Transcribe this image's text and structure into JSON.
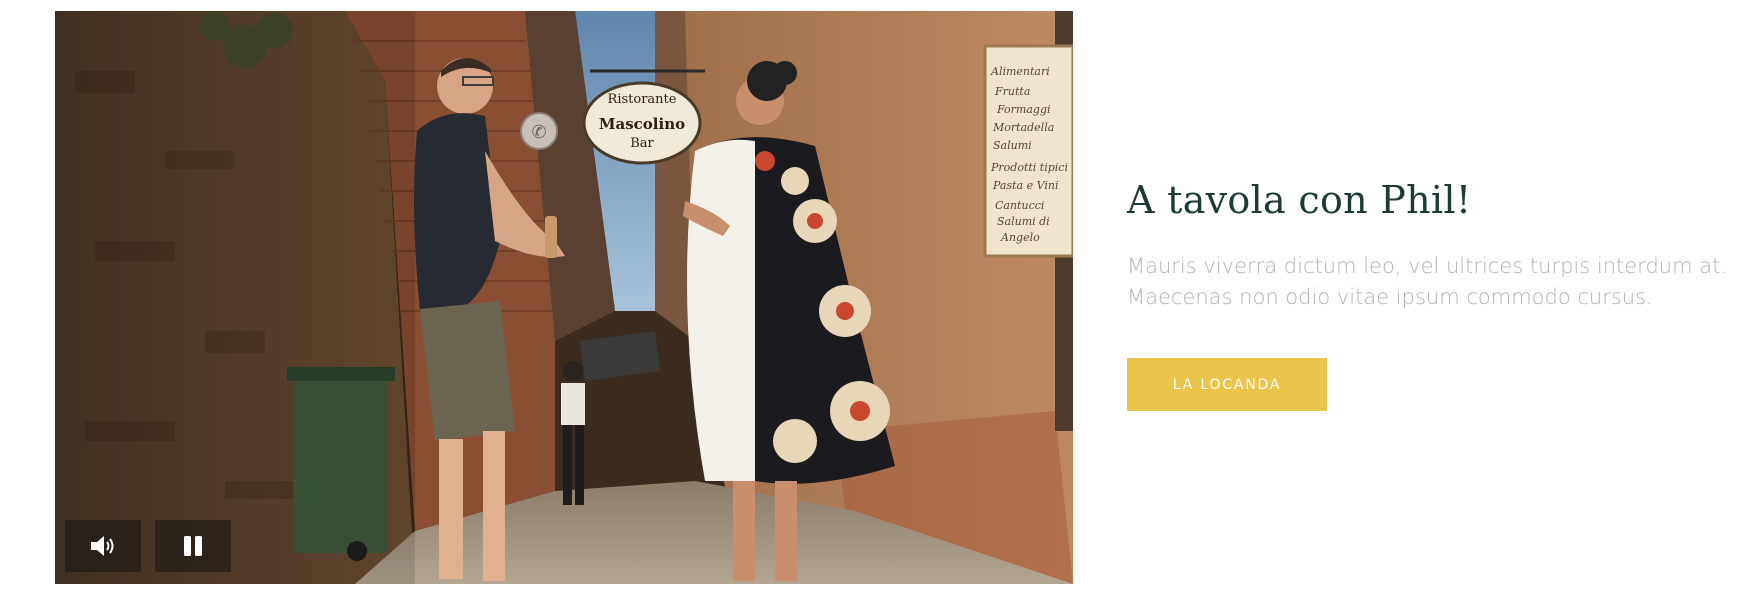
{
  "video": {
    "sign": {
      "line1": "Ristorante",
      "line2": "Mascolino",
      "line3": "Bar"
    },
    "shop_board": [
      "Alimentari",
      "Frutta",
      "Formaggi",
      "Mortadella",
      "Salumi",
      "Prodotti tipici",
      "Pasta e Vini",
      "Cantucci",
      "Salumi di",
      "Angelo"
    ],
    "controls": {
      "mute_icon": "volume-icon",
      "pause_icon": "pause-icon",
      "state": "playing"
    }
  },
  "content": {
    "title": "A tavola con Phil!",
    "description": "Mauris viverra dictum leo, vel ultrices turpis interdum at. Maecenas non odio vitae ipsum commodo cursus.",
    "button_label": "LA LOCANDA"
  },
  "colors": {
    "title": "#1c3b36",
    "description": "#b3b3b3",
    "button": "#ecc44a",
    "button_text": "#ffffff"
  }
}
